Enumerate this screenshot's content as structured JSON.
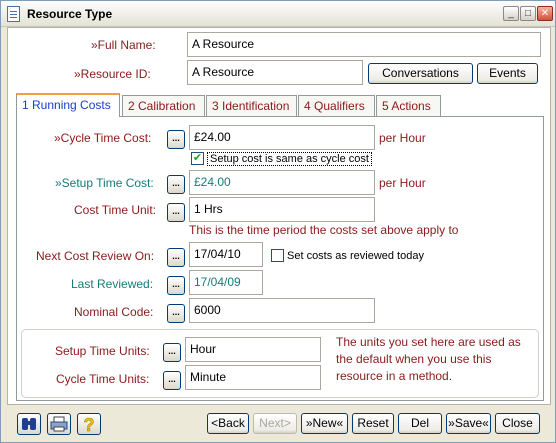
{
  "window": {
    "title": "Resource Type",
    "minimize": "_",
    "maximize": "□",
    "close": "✕"
  },
  "header": {
    "full_name_label": "»Full Name:",
    "full_name_value": "A Resource",
    "resource_id_label": "»Resource ID:",
    "resource_id_value": "A Resource",
    "conversations_button": "Conversations",
    "events_button": "Events"
  },
  "tabs": [
    {
      "label": "1 Running Costs",
      "active": true
    },
    {
      "label": "2 Calibration",
      "active": false
    },
    {
      "label": "3 Identification",
      "active": false
    },
    {
      "label": "4 Qualifiers",
      "active": false
    },
    {
      "label": "5 Actions",
      "active": false
    }
  ],
  "running_costs": {
    "cycle_time_cost_label": "»Cycle Time Cost:",
    "cycle_time_cost_value": "£24.00",
    "cycle_time_cost_unit": "per Hour",
    "setup_same_checkbox_label": "Setup cost is same as cycle cost",
    "setup_same_checked": true,
    "setup_time_cost_label": "»Setup Time Cost:",
    "setup_time_cost_value": "£24.00",
    "setup_time_cost_unit": "per Hour",
    "cost_time_unit_label": "Cost Time Unit:",
    "cost_time_unit_value": "1 Hrs",
    "cost_time_unit_note": "This is the time period the costs set above apply to",
    "next_cost_review_label": "Next Cost Review On:",
    "next_cost_review_value": "17/04/10",
    "set_reviewed_label": "Set costs as reviewed today",
    "set_reviewed_checked": false,
    "last_reviewed_label": "Last Reviewed:",
    "last_reviewed_value": "17/04/09",
    "nominal_code_label": "Nominal Code:",
    "nominal_code_value": "6000",
    "setup_time_units_label": "Setup Time Units:",
    "setup_time_units_value": "Hour",
    "cycle_time_units_label": "Cycle Time Units:",
    "cycle_time_units_value": "Minute",
    "units_note": "The units you set here are used as the default when you use this resource in a method."
  },
  "ellipsis": "...",
  "footer": {
    "back": "<Back",
    "next": "Next>",
    "new": "»New«",
    "reset": "Reset",
    "del": "Del",
    "save": "»Save«",
    "close": "Close"
  }
}
